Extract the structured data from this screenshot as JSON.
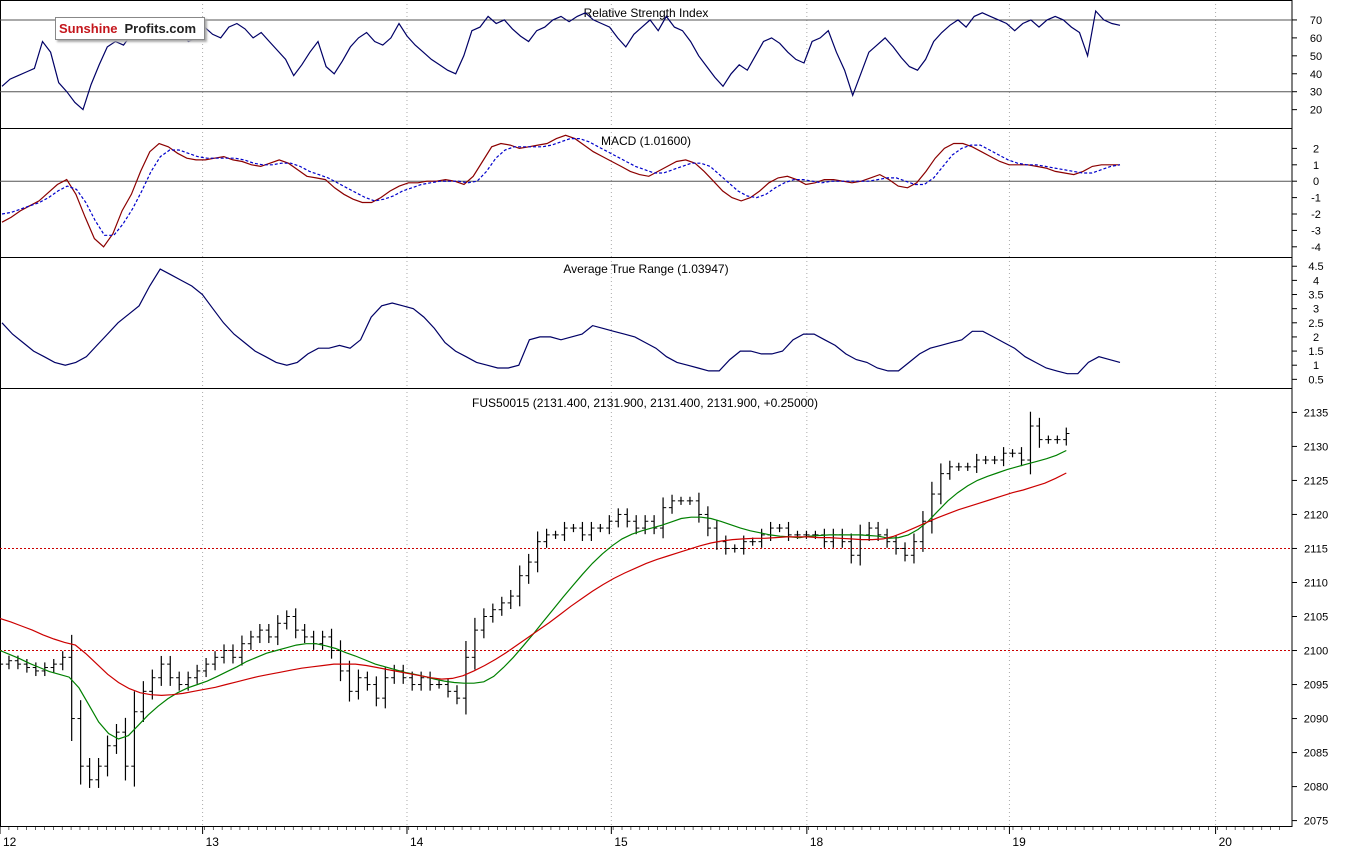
{
  "logo": {
    "part1": "Sunshine",
    "part2": "Profits.com"
  },
  "colors": {
    "price": "#000000",
    "ma_green": "#008000",
    "ma_red": "#cc0000",
    "indicator": "#000066",
    "signal": "#0000cc",
    "grid": "#aaaaaa",
    "ref_line": "#cc0000"
  },
  "chart_data": [
    {
      "type": "line",
      "title": "Relative Strength Index",
      "ylim": [
        12,
        80
      ],
      "yticks": [
        70,
        60,
        50,
        40,
        30,
        20
      ],
      "ref_lines": [
        70,
        30
      ],
      "series": [
        {
          "values": [
            33,
            37,
            39,
            41,
            43,
            58,
            52,
            35,
            30,
            24,
            20,
            34,
            45,
            55,
            58,
            56,
            62,
            60,
            63,
            64,
            61,
            63,
            65,
            58,
            60,
            66,
            62,
            60,
            66,
            68,
            65,
            60,
            63,
            58,
            53,
            48,
            39,
            45,
            52,
            58,
            44,
            40,
            47,
            55,
            60,
            63,
            58,
            56,
            60,
            68,
            61,
            56,
            52,
            48,
            45,
            42,
            40,
            50,
            64,
            66,
            72,
            68,
            70,
            65,
            61,
            58,
            64,
            66,
            70,
            72,
            69,
            72,
            74,
            70,
            68,
            66,
            60,
            55,
            62,
            66,
            70,
            64,
            72,
            66,
            64,
            58,
            50,
            44,
            38,
            33,
            40,
            45,
            42,
            50,
            58,
            60,
            57,
            52,
            48,
            46,
            58,
            60,
            64,
            52,
            42,
            28,
            40,
            52,
            56,
            60,
            55,
            49,
            44,
            42,
            48,
            58,
            63,
            67,
            70,
            66,
            72,
            74,
            72,
            70,
            68,
            64,
            68,
            70,
            66,
            70,
            72,
            70,
            66,
            63,
            50,
            75,
            70,
            68,
            67
          ]
        }
      ]
    },
    {
      "type": "line",
      "title": "MACD (1.01600)",
      "ylim": [
        -4.5,
        3
      ],
      "yticks": [
        2,
        1,
        0,
        -1,
        -2,
        -3,
        -4
      ],
      "ref_lines": [
        0
      ],
      "series": [
        {
          "values": [
            -2.5,
            -2.2,
            -1.8,
            -1.5,
            -1.2,
            -0.7,
            -0.2,
            0.1,
            -0.8,
            -2.2,
            -3.5,
            -4,
            -3.2,
            -1.8,
            -0.8,
            0.6,
            1.8,
            2.3,
            2.1,
            1.7,
            1.4,
            1.3,
            1.3,
            1.4,
            1.5,
            1.3,
            1.2,
            1.0,
            0.9,
            1.1,
            1.3,
            1.1,
            0.7,
            0.3,
            0.2,
            0.1,
            -0.4,
            -0.8,
            -1.1,
            -1.3,
            -1.3,
            -1.0,
            -0.6,
            -0.3,
            -0.1,
            -0.1,
            0.0,
            0.0,
            0.1,
            0.0,
            -0.2,
            0.3,
            1.2,
            2.1,
            2.3,
            2.2,
            2.0,
            2.1,
            2.2,
            2.3,
            2.6,
            2.8,
            2.6,
            2.2,
            1.8,
            1.5,
            1.2,
            0.9,
            0.6,
            0.4,
            0.3,
            0.6,
            0.9,
            1.2,
            1.3,
            1.1,
            0.6,
            0.0,
            -0.6,
            -1.0,
            -1.2,
            -1.0,
            -0.6,
            -0.1,
            0.2,
            0.3,
            0.1,
            -0.2,
            -0.1,
            0.1,
            0.1,
            0.0,
            -0.1,
            0.0,
            0.2,
            0.4,
            0.1,
            -0.3,
            -0.4,
            -0.1,
            0.6,
            1.4,
            2.0,
            2.3,
            2.3,
            2.1,
            1.8,
            1.5,
            1.2,
            1.0,
            1.0,
            1.0,
            0.9,
            0.8,
            0.6,
            0.5,
            0.4,
            0.6,
            0.9,
            1.0,
            1.0,
            1.0
          ]
        },
        {
          "values": [
            -2.0,
            -1.9,
            -1.7,
            -1.5,
            -1.3,
            -1.0,
            -0.6,
            -0.3,
            -0.5,
            -1.3,
            -2.4,
            -3.3,
            -3.3,
            -2.6,
            -1.7,
            -0.6,
            0.6,
            1.5,
            1.9,
            1.9,
            1.7,
            1.5,
            1.4,
            1.4,
            1.4,
            1.4,
            1.3,
            1.1,
            1.0,
            1.0,
            1.1,
            1.1,
            0.9,
            0.6,
            0.4,
            0.2,
            -0.1,
            -0.4,
            -0.7,
            -1.0,
            -1.2,
            -1.1,
            -0.9,
            -0.6,
            -0.4,
            -0.2,
            -0.1,
            0.0,
            0.0,
            0.0,
            -0.1,
            0.0,
            0.6,
            1.4,
            1.9,
            2.1,
            2.1,
            2.1,
            2.1,
            2.2,
            2.4,
            2.6,
            2.6,
            2.4,
            2.1,
            1.8,
            1.5,
            1.2,
            0.9,
            0.7,
            0.5,
            0.5,
            0.7,
            0.9,
            1.1,
            1.1,
            0.9,
            0.4,
            -0.1,
            -0.6,
            -0.9,
            -1.0,
            -0.8,
            -0.4,
            -0.1,
            0.1,
            0.1,
            0.0,
            -0.1,
            0.0,
            0.0,
            0.0,
            0.0,
            0.0,
            0.1,
            0.2,
            0.2,
            0.0,
            -0.2,
            -0.2,
            0.2,
            0.9,
            1.6,
            2.0,
            2.2,
            2.2,
            1.9,
            1.6,
            1.3,
            1.1,
            1.0,
            1.0,
            0.9,
            0.8,
            0.7,
            0.6,
            0.5,
            0.5,
            0.7,
            0.9,
            1.0
          ]
        }
      ]
    },
    {
      "type": "line",
      "title": "Average True Range (1.03947)",
      "ylim": [
        0.3,
        4.65
      ],
      "yticks": [
        4.5,
        4.0,
        3.5,
        3.0,
        2.5,
        2.0,
        1.5,
        1.0,
        0.5
      ],
      "series": [
        {
          "values": [
            2.5,
            2.1,
            1.8,
            1.5,
            1.3,
            1.1,
            1.0,
            1.1,
            1.3,
            1.7,
            2.1,
            2.5,
            2.8,
            3.1,
            3.8,
            4.4,
            4.2,
            4.0,
            3.8,
            3.5,
            3.0,
            2.5,
            2.1,
            1.8,
            1.5,
            1.3,
            1.1,
            1.0,
            1.1,
            1.4,
            1.6,
            1.6,
            1.7,
            1.6,
            1.9,
            2.7,
            3.1,
            3.2,
            3.1,
            3.0,
            2.7,
            2.3,
            1.8,
            1.5,
            1.3,
            1.1,
            1.0,
            0.9,
            0.9,
            1.0,
            1.9,
            2.0,
            2.0,
            1.9,
            2.0,
            2.1,
            2.4,
            2.3,
            2.2,
            2.1,
            2.0,
            1.8,
            1.6,
            1.3,
            1.1,
            1.0,
            0.9,
            0.8,
            0.8,
            1.2,
            1.5,
            1.5,
            1.4,
            1.4,
            1.5,
            1.9,
            2.1,
            2.1,
            1.9,
            1.7,
            1.4,
            1.2,
            1.1,
            0.9,
            0.8,
            0.8,
            1.1,
            1.4,
            1.6,
            1.7,
            1.8,
            1.9,
            2.2,
            2.2,
            2.0,
            1.8,
            1.6,
            1.3,
            1.1,
            0.9,
            0.8,
            0.7,
            0.7,
            1.1,
            1.3,
            1.2,
            1.1
          ]
        }
      ]
    },
    {
      "type": "line",
      "title": "FUS50015 (2131.400, 2131.900, 2131.400, 2131.900, +0.25000)",
      "ylim": [
        2074.5,
        2138
      ],
      "yticks": [
        2135,
        2130,
        2125,
        2120,
        2115,
        2110,
        2105,
        2100,
        2095,
        2090,
        2085,
        2080,
        2075
      ],
      "ref_lines": [
        2115,
        2100
      ],
      "x_ticks": [
        {
          "label": "12",
          "pos": 0
        },
        {
          "label": "13",
          "pos": 22.8
        },
        {
          "label": "14",
          "pos": 45.8
        },
        {
          "label": "15",
          "pos": 68.8
        },
        {
          "label": "18",
          "pos": 90.8
        },
        {
          "label": "19",
          "pos": 113.6
        },
        {
          "label": "20",
          "pos": 136.8
        }
      ],
      "x_range": [
        0,
        145.4
      ],
      "series": [
        {
          "name": "price",
          "values": [
            2098,
            2098.5,
            2098,
            2097.5,
            2097,
            2097.5,
            2098,
            2099,
            2090,
            2083,
            2081,
            2083,
            2086,
            2088,
            2083,
            2091,
            2094,
            2096,
            2098,
            2096,
            2095,
            2096,
            2097,
            2098,
            2099,
            2100,
            2099,
            2101,
            2102,
            2103,
            2102,
            2104,
            2105,
            2103,
            2102,
            2101,
            2102,
            2100,
            2097,
            2094,
            2096,
            2095,
            2093,
            2096,
            2097,
            2096,
            2095,
            2096,
            2095,
            2095,
            2094,
            2093,
            2099,
            2103,
            2105,
            2106,
            2107,
            2108,
            2111,
            2113,
            2116,
            2117,
            2117,
            2118,
            2118,
            2117,
            2118,
            2118,
            2119,
            2120,
            2119,
            2118,
            2119,
            2118,
            2121,
            2122,
            2122,
            2122,
            2120,
            2118,
            2116,
            2115,
            2115,
            2116,
            2116,
            2117,
            2118,
            2118,
            2117,
            2117,
            2117,
            2117,
            2116,
            2117,
            2116,
            2114,
            2117,
            2118,
            2117,
            2116,
            2115,
            2114,
            2116,
            2119,
            2123,
            2126,
            2127,
            2127,
            2127,
            2128,
            2128,
            2128,
            2129,
            2129,
            2128,
            2133,
            2131,
            2131,
            2131,
            2131.9
          ]
        },
        {
          "name": "ma_green",
          "values": [
            2100,
            2099.4,
            2098.8,
            2098.1,
            2097.5,
            2096.9,
            2096.5,
            2096.1,
            2094.5,
            2092,
            2089.5,
            2087.8,
            2087,
            2087.5,
            2089,
            2090.5,
            2091.8,
            2092.9,
            2093.8,
            2094.5,
            2095,
            2095.5,
            2096.2,
            2096.9,
            2097.6,
            2098.4,
            2099,
            2099.6,
            2100,
            2100.4,
            2100.8,
            2101,
            2101,
            2100.7,
            2100.3,
            2099.7,
            2099.2,
            2098.6,
            2098,
            2097.6,
            2097.2,
            2096.8,
            2096.5,
            2096.2,
            2095.8,
            2095.5,
            2095.3,
            2095.2,
            2095.2,
            2095.4,
            2096.2,
            2097.5,
            2099,
            2100.7,
            2102.4,
            2104.2,
            2106,
            2107.8,
            2109.5,
            2111.2,
            2112.8,
            2114.2,
            2115.4,
            2116.4,
            2117.1,
            2117.6,
            2118,
            2118.4,
            2118.9,
            2119.4,
            2119.6,
            2119.6,
            2119.4,
            2119,
            2118.5,
            2118,
            2117.6,
            2117.3,
            2117,
            2116.8,
            2116.7,
            2116.6,
            2116.8,
            2116.9,
            2117,
            2117,
            2117,
            2117,
            2116.9,
            2116.8,
            2116.5,
            2116.6,
            2117,
            2117.8,
            2119,
            2120.5,
            2122,
            2123.2,
            2124.2,
            2125,
            2125.6,
            2126.1,
            2126.6,
            2127,
            2127.4,
            2127.8,
            2128.2,
            2128.7,
            2129.4
          ]
        },
        {
          "name": "ma_red",
          "values": [
            2104.7,
            2104.2,
            2103.6,
            2103,
            2102.3,
            2101.7,
            2101.2,
            2100.8,
            2099.5,
            2098,
            2096.5,
            2095.3,
            2094.4,
            2093.8,
            2093.5,
            2093.4,
            2093.5,
            2093.7,
            2094,
            2094.3,
            2094.6,
            2095,
            2095.4,
            2095.8,
            2096.2,
            2096.5,
            2096.8,
            2097.1,
            2097.4,
            2097.6,
            2097.8,
            2098,
            2098,
            2098,
            2097.8,
            2097.5,
            2097.2,
            2096.9,
            2096.6,
            2096.3,
            2096,
            2095.8,
            2095.9,
            2096.3,
            2097,
            2097.8,
            2098.7,
            2099.7,
            2100.8,
            2101.9,
            2103,
            2104.1,
            2105.3,
            2106.5,
            2107.6,
            2108.7,
            2109.7,
            2110.6,
            2111.4,
            2112.1,
            2112.8,
            2113.4,
            2113.9,
            2114.4,
            2114.9,
            2115.4,
            2115.8,
            2116.1,
            2116.3,
            2116.4,
            2116.5,
            2116.5,
            2116.6,
            2116.7,
            2116.7,
            2116.7,
            2116.6,
            2116.6,
            2116.5,
            2116.4,
            2116.3,
            2116.3,
            2116.4,
            2116.8,
            2117.4,
            2118.1,
            2118.8,
            2119.5,
            2120.1,
            2120.7,
            2121.2,
            2121.7,
            2122.2,
            2122.7,
            2123.2,
            2123.6,
            2124.1,
            2124.6,
            2125.3,
            2126.1
          ]
        }
      ]
    }
  ]
}
